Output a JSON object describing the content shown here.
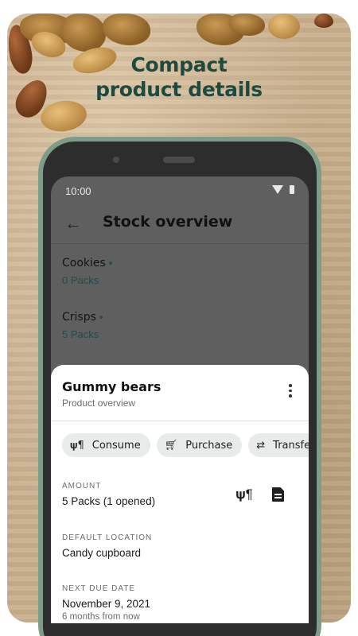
{
  "promo": {
    "headline_line1": "Compact",
    "headline_line2": "product details"
  },
  "status_bar": {
    "time": "10:00",
    "icons": [
      "wifi-icon",
      "battery-icon"
    ]
  },
  "appbar": {
    "back_icon": "arrow-left-icon",
    "title": "Stock overview"
  },
  "stock_list": [
    {
      "name": "Cookies",
      "amount": "0 Packs"
    },
    {
      "name": "Crisps",
      "amount": "5 Packs"
    }
  ],
  "sheet": {
    "title": "Gummy bears",
    "subtitle": "Product overview",
    "actions": [
      {
        "label": "Consume",
        "icon": "fork-knife-icon"
      },
      {
        "label": "Purchase",
        "icon": "cart-icon"
      },
      {
        "label": "Transfer",
        "icon": "swap-arrows-icon"
      }
    ],
    "amount": {
      "label": "AMOUNT",
      "value": "5 Packs (1 opened)"
    },
    "location": {
      "label": "DEFAULT LOCATION",
      "value": "Candy cupboard"
    },
    "due": {
      "label": "NEXT DUE DATE",
      "value": "November 9, 2021",
      "sub": "6 months from now"
    }
  },
  "colors": {
    "headline": "#1f4a40",
    "phone_frame": "#7d9c89",
    "chip_bg": "#e7ecea",
    "accent_dot": "#2b4f47"
  }
}
